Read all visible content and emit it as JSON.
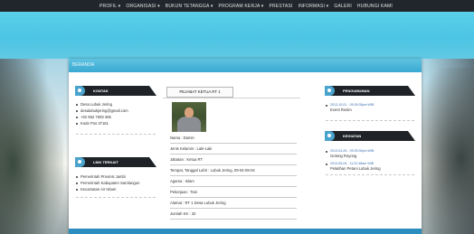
{
  "nav": {
    "items": [
      "PROFIL ▾",
      "ORGANISASI ▾",
      "BUKUN TETANGGA ▾",
      "PROGRAM KERJA ▾",
      "PRESTASI",
      "INFORMASI ▾",
      "GALERI",
      "HUBUNGI KAMI"
    ]
  },
  "page": {
    "title": "BERANDA"
  },
  "left": {
    "kontak": {
      "title": "KONTAK",
      "items": [
        "Desa Lubuk Jering",
        "desalubukjering@gmail.com",
        "+62 852 7693 365",
        "Kode Pos 37161"
      ]
    },
    "links": {
      "title": "LINK TERKAIT",
      "items": [
        "Pemerintah Provinsi Jambi",
        "Pemerintah Kabupaten Sarolangun",
        "Kecamatan Air Hitam"
      ]
    }
  },
  "center": {
    "tab_label": "PEJABAT KETUA RT 1",
    "fields": [
      "Nama : Damin",
      "Jenis Kelamin : Laki-Laki",
      "Jabatan : Ketua RT",
      "Tempat, Tanggal Lahir : Lubuk Jering, 09-04-08-04",
      "Agama : Islam",
      "Pekerjaan : Tani",
      "Alamat : RT 1 Desa Lubuk Jering",
      "Jumlah KK : 32"
    ]
  },
  "right": {
    "pengumuman": {
      "title": "PENGUMUMAN",
      "items": [
        {
          "meta": "2013-10-01 - 09:26:35pm WIB",
          "title": "Event Rosim"
        }
      ]
    },
    "kegiatan": {
      "title": "KEGIATAN",
      "items": [
        {
          "meta": "2013-04-25 - 09:25:30pm WIB",
          "title": "Gotong Royong"
        },
        {
          "meta": "2013-05-04 - 11:22:48am WIB",
          "title": "Pelatihan Petani Lubuk Jering"
        }
      ]
    }
  },
  "colors": {
    "header": "#4cc4e4",
    "nav_bg": "#20262b",
    "widget_head": "#1f2327",
    "accent": "#4aa3cc"
  }
}
